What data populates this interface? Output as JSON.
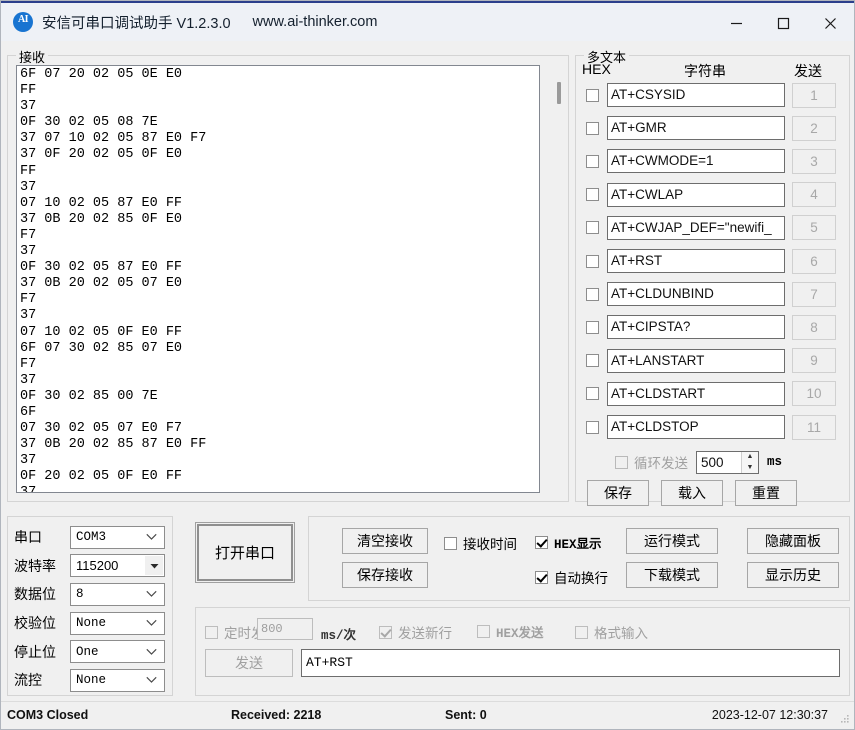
{
  "window": {
    "title": "安信可串口调试助手 V1.2.3.0",
    "url": "www.ai-thinker.com",
    "icon_label": "AI",
    "minimize_icon": "minimize-icon",
    "maximize_icon": "maximize-icon",
    "close_icon": "close-icon"
  },
  "receive": {
    "legend": "接收",
    "content": "6F 07 20 02 05 0E E0\nFF\n37\n0F 30 02 05 08 7E\n37 07 10 02 05 87 E0 F7\n37 0F 20 02 05 0F E0\nFF\n37\n07 10 02 05 87 E0 FF\n37 0B 20 02 85 0F E0\nF7\n37\n0F 30 02 05 87 E0 FF\n37 0B 20 02 05 07 E0\nF7\n37\n07 10 02 05 0F E0 FF\n6F 07 30 02 85 07 E0\nF7\n37\n0F 30 02 85 00 7E\n6F\n07 30 02 05 07 E0 F7\n37 0B 20 02 85 87 E0 FF\n37\n0F 20 02 05 0F E0 FF\n37"
  },
  "multitext": {
    "legend": "多文本",
    "col_hex": "HEX",
    "col_string": "字符串",
    "col_send": "发送",
    "rows": [
      {
        "checked": false,
        "value": "AT+CSYSID",
        "send": "1"
      },
      {
        "checked": false,
        "value": "AT+GMR",
        "send": "2"
      },
      {
        "checked": false,
        "value": "AT+CWMODE=1",
        "send": "3"
      },
      {
        "checked": false,
        "value": "AT+CWLAP",
        "send": "4"
      },
      {
        "checked": false,
        "value": "AT+CWJAP_DEF=\"newifi_",
        "send": "5"
      },
      {
        "checked": false,
        "value": "AT+RST",
        "send": "6"
      },
      {
        "checked": false,
        "value": "AT+CLDUNBIND",
        "send": "7"
      },
      {
        "checked": false,
        "value": "AT+CIPSTA?",
        "send": "8"
      },
      {
        "checked": false,
        "value": "AT+LANSTART",
        "send": "9"
      },
      {
        "checked": false,
        "value": "AT+CLDSTART",
        "send": "10"
      },
      {
        "checked": false,
        "value": "AT+CLDSTOP",
        "send": "11"
      }
    ],
    "loop_label": "循环发送",
    "loop_checked": false,
    "loop_interval": "500",
    "loop_unit": "ms",
    "save_label": "保存",
    "load_label": "载入",
    "reset_label": "重置"
  },
  "serial": {
    "rows": [
      {
        "label": "串口",
        "value": "COM3",
        "editable": false
      },
      {
        "label": "波特率",
        "value": "115200",
        "editable": true
      },
      {
        "label": "数据位",
        "value": "8",
        "editable": false
      },
      {
        "label": "校验位",
        "value": "None",
        "editable": false
      },
      {
        "label": "停止位",
        "value": "One",
        "editable": false
      },
      {
        "label": "流控",
        "value": "None",
        "editable": false
      }
    ],
    "open_button": "打开串口"
  },
  "recvoptions": {
    "clear_recv": "清空接收",
    "save_recv": "保存接收",
    "recv_time_label": "接收时间",
    "recv_time_checked": false,
    "hex_display_label": "HEX显示",
    "hex_display_checked": true,
    "auto_wrap_label": "自动换行",
    "auto_wrap_checked": true,
    "run_mode": "运行模式",
    "download_mode": "下载模式",
    "hide_panel": "隐藏面板",
    "show_history": "显示历史"
  },
  "send": {
    "timed_label": "定时发送",
    "timed_checked": false,
    "interval_value": "800",
    "interval_unit": "ms/次",
    "newline_label": "发送新行",
    "newline_checked": true,
    "hex_send_label": "HEX发送",
    "hex_send_checked": false,
    "format_input_label": "格式输入",
    "format_input_checked": false,
    "send_button": "发送",
    "input_value": "AT+RST"
  },
  "status": {
    "port_state": "COM3 Closed",
    "received": "Received: 2218",
    "sent": "Sent: 0",
    "datetime": "2023-12-07 12:30:37"
  }
}
